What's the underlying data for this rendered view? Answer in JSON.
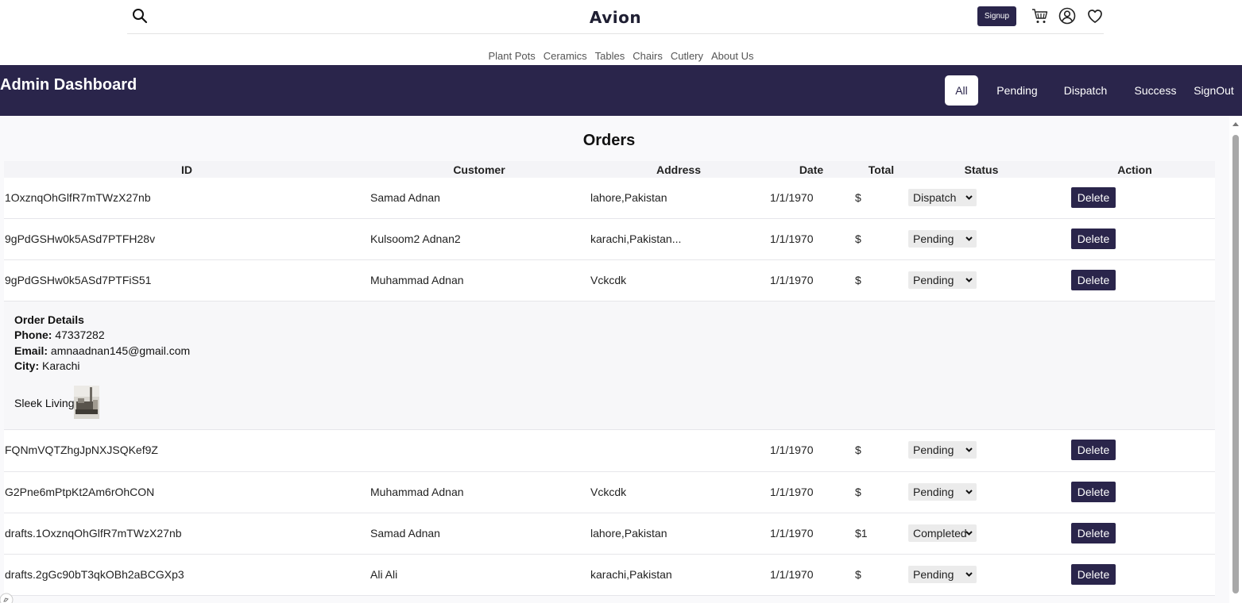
{
  "brand": "Avion",
  "signup_label": "Signup",
  "nav": [
    "Plant Pots",
    "Ceramics",
    "Tables",
    "Chairs",
    "Cutlery",
    "About Us"
  ],
  "admin": {
    "title": "Admin Dashboard",
    "filters": [
      "All",
      "Pending",
      "Dispatch",
      "Success"
    ],
    "active_filter": "All",
    "signout": "SignOut"
  },
  "orders": {
    "title": "Orders",
    "columns": [
      "ID",
      "Customer",
      "Address",
      "Date",
      "Total",
      "Status",
      "Action"
    ],
    "delete_label": "Delete",
    "rows": [
      {
        "id": "1OxznqOhGlfR7mTWzX27nb",
        "customer": "Samad Adnan",
        "address": "lahore,Pakistan",
        "date": "1/1/1970",
        "total": "$",
        "status": "Dispatch"
      },
      {
        "id": "9gPdGSHw0k5ASd7PTFH28v",
        "customer": "Kulsoom2 Adnan2",
        "address": "karachi,Pakistan...",
        "date": "1/1/1970",
        "total": "$",
        "status": "Pending"
      },
      {
        "id": "9gPdGSHw0k5ASd7PTFiS51",
        "customer": "Muhammad Adnan",
        "address": "Vckcdk",
        "date": "1/1/1970",
        "total": "$",
        "status": "Pending"
      },
      {
        "id": "FQNmVQTZhgJpNXJSQKef9Z",
        "customer": "",
        "address": "",
        "date": "1/1/1970",
        "total": "$",
        "status": "Pending"
      },
      {
        "id": "G2Pne6mPtpKt2Am6rOhCON",
        "customer": "Muhammad Adnan",
        "address": "Vckcdk",
        "date": "1/1/1970",
        "total": "$",
        "status": "Pending"
      },
      {
        "id": "drafts.1OxznqOhGlfR7mTWzX27nb",
        "customer": "Samad Adnan",
        "address": "lahore,Pakistan",
        "date": "1/1/1970",
        "total": "$1",
        "status": "Completed"
      },
      {
        "id": "drafts.2gGc90bT3qkOBh2aBCGXp3",
        "customer": "Ali Ali",
        "address": "karachi,Pakistan",
        "date": "1/1/1970",
        "total": "$",
        "status": "Pending"
      }
    ],
    "details": {
      "title": "Order Details",
      "phone_label": "Phone:",
      "phone": "47337282",
      "email_label": "Email:",
      "email": "amnaadnan145@gmail.com",
      "city_label": "City:",
      "city": "Karachi",
      "product": "Sleek Living"
    }
  }
}
